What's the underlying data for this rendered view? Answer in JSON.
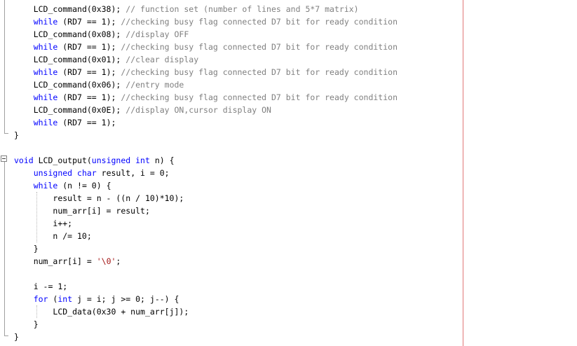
{
  "code_lines": [
    {
      "t": 4,
      "indent": "    ",
      "parts": [
        {
          "c": "tok",
          "v": "LCD_command(0x38); "
        },
        {
          "c": "cm",
          "v": "// function set (number of lines and 5*7 matrix)"
        }
      ]
    },
    {
      "t": 22,
      "indent": "    ",
      "parts": [
        {
          "c": "kw",
          "v": "while"
        },
        {
          "c": "tok",
          "v": " (RD7 == 1); "
        },
        {
          "c": "cm",
          "v": "//checking busy flag connected D7 bit for ready condition"
        }
      ]
    },
    {
      "t": 40,
      "indent": "    ",
      "parts": [
        {
          "c": "tok",
          "v": "LCD_command(0x08); "
        },
        {
          "c": "cm",
          "v": "//display OFF"
        }
      ]
    },
    {
      "t": 58,
      "indent": "    ",
      "parts": [
        {
          "c": "kw",
          "v": "while"
        },
        {
          "c": "tok",
          "v": " (RD7 == 1); "
        },
        {
          "c": "cm",
          "v": "//checking busy flag connected D7 bit for ready condition"
        }
      ]
    },
    {
      "t": 76,
      "indent": "    ",
      "parts": [
        {
          "c": "tok",
          "v": "LCD_command(0x01); "
        },
        {
          "c": "cm",
          "v": "//clear display"
        }
      ]
    },
    {
      "t": 94,
      "indent": "    ",
      "parts": [
        {
          "c": "kw",
          "v": "while"
        },
        {
          "c": "tok",
          "v": " (RD7 == 1); "
        },
        {
          "c": "cm",
          "v": "//checking busy flag connected D7 bit for ready condition"
        }
      ]
    },
    {
      "t": 112,
      "indent": "    ",
      "parts": [
        {
          "c": "tok",
          "v": "LCD_command(0x06); "
        },
        {
          "c": "cm",
          "v": "//entry mode"
        }
      ]
    },
    {
      "t": 130,
      "indent": "    ",
      "parts": [
        {
          "c": "kw",
          "v": "while"
        },
        {
          "c": "tok",
          "v": " (RD7 == 1); "
        },
        {
          "c": "cm",
          "v": "//checking busy flag connected D7 bit for ready condition"
        }
      ]
    },
    {
      "t": 148,
      "indent": "    ",
      "parts": [
        {
          "c": "tok",
          "v": "LCD_command(0x0E); "
        },
        {
          "c": "cm",
          "v": "//display ON,cursor display ON"
        }
      ]
    },
    {
      "t": 166,
      "indent": "    ",
      "parts": [
        {
          "c": "kw",
          "v": "while"
        },
        {
          "c": "tok",
          "v": " (RD7 == 1);"
        }
      ]
    },
    {
      "t": 184,
      "indent": "",
      "parts": [
        {
          "c": "tok",
          "v": "}"
        }
      ]
    },
    {
      "t": 220,
      "indent": "",
      "parts": [
        {
          "c": "kw",
          "v": "void"
        },
        {
          "c": "tok",
          "v": " LCD_output("
        },
        {
          "c": "kw",
          "v": "unsigned"
        },
        {
          "c": "tok",
          "v": " "
        },
        {
          "c": "kw",
          "v": "int"
        },
        {
          "c": "tok",
          "v": " n) {"
        }
      ]
    },
    {
      "t": 238,
      "indent": "    ",
      "parts": [
        {
          "c": "kw",
          "v": "unsigned"
        },
        {
          "c": "tok",
          "v": " "
        },
        {
          "c": "kw",
          "v": "char"
        },
        {
          "c": "tok",
          "v": " result, i = 0;"
        }
      ]
    },
    {
      "t": 256,
      "indent": "    ",
      "parts": [
        {
          "c": "kw",
          "v": "while"
        },
        {
          "c": "tok",
          "v": " (n != 0) {"
        }
      ]
    },
    {
      "t": 274,
      "indent": "        ",
      "parts": [
        {
          "c": "tok",
          "v": "result = n - ((n / 10)*10);"
        }
      ]
    },
    {
      "t": 292,
      "indent": "        ",
      "parts": [
        {
          "c": "tok",
          "v": "num_arr[i] = result;"
        }
      ]
    },
    {
      "t": 310,
      "indent": "        ",
      "parts": [
        {
          "c": "tok",
          "v": "i++;"
        }
      ]
    },
    {
      "t": 328,
      "indent": "        ",
      "parts": [
        {
          "c": "tok",
          "v": "n /= 10;"
        }
      ]
    },
    {
      "t": 346,
      "indent": "    ",
      "parts": [
        {
          "c": "tok",
          "v": "}"
        }
      ]
    },
    {
      "t": 364,
      "indent": "    ",
      "parts": [
        {
          "c": "tok",
          "v": "num_arr[i] = "
        },
        {
          "c": "str",
          "v": "'\\0'"
        },
        {
          "c": "tok",
          "v": ";"
        }
      ]
    },
    {
      "t": 400,
      "indent": "    ",
      "parts": [
        {
          "c": "tok",
          "v": "i -= 1;"
        }
      ]
    },
    {
      "t": 418,
      "indent": "    ",
      "parts": [
        {
          "c": "kw",
          "v": "for"
        },
        {
          "c": "tok",
          "v": " ("
        },
        {
          "c": "kw",
          "v": "int"
        },
        {
          "c": "tok",
          "v": " j = i; j >= 0; j--) {"
        }
      ]
    },
    {
      "t": 436,
      "indent": "        ",
      "parts": [
        {
          "c": "tok",
          "v": "LCD_data(0x30 + num_arr[j]);"
        }
      ]
    },
    {
      "t": 454,
      "indent": "    ",
      "parts": [
        {
          "c": "tok",
          "v": "}"
        }
      ]
    },
    {
      "t": 472,
      "indent": "",
      "parts": [
        {
          "c": "tok",
          "v": "}"
        }
      ]
    }
  ],
  "colors": {
    "keyword": "#0000ff",
    "comment": "#808080",
    "string": "#a31515",
    "text": "#000000",
    "edge_line": "#e07878"
  }
}
